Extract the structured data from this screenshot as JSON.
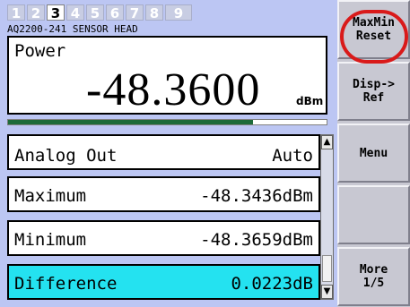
{
  "tabs": [
    "1",
    "2",
    "3",
    "4",
    "5",
    "6",
    "7",
    "8",
    "9"
  ],
  "active_tab": "3",
  "sensor_label": "AQ2200-241 SENSOR HEAD",
  "power": {
    "label": "Power",
    "value": "-48.3600",
    "unit": "dBm"
  },
  "bargraph": {
    "level": 0.77,
    "color": "#1d6b3a"
  },
  "list": {
    "rows": [
      {
        "label": "Analog Out",
        "value": "Auto"
      },
      {
        "label": "Maximum",
        "value": "-48.3436dBm"
      },
      {
        "label": "Minimum",
        "value": "-48.3659dBm"
      },
      {
        "label": "Difference",
        "value": "0.0223dB"
      }
    ],
    "selected_index": 3
  },
  "scrollbar": {
    "up_icon": "triangle-up",
    "down_icon": "triangle-down",
    "up_glyph": "▲",
    "down_glyph": "▼"
  },
  "softkeys": [
    {
      "label": "MaxMin\nReset"
    },
    {
      "label": "Disp->\nRef"
    },
    {
      "label": "Menu"
    },
    {
      "label": ""
    },
    {
      "label": "More\n1/5"
    }
  ],
  "colors": {
    "panel_bg": "#bcc6f3",
    "selected_row": "#24e2f0",
    "highlight": "#d91a1a"
  }
}
